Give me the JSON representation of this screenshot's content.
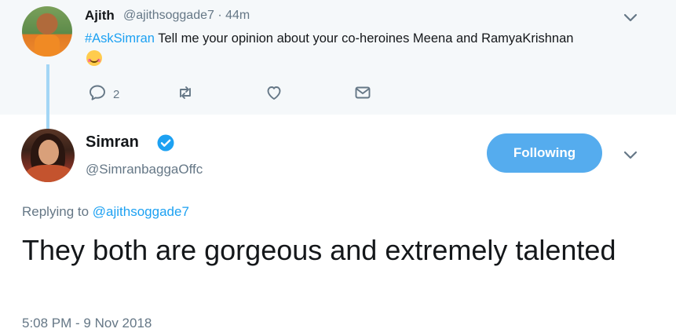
{
  "parent_tweet": {
    "name": "Ajith",
    "handle": "@ajithsoggade7",
    "separator": "·",
    "time": "44m",
    "hashtag": "#AskSimran",
    "text": " Tell me your opinion about your co-heroines Meena and RamyaKrishnan",
    "reply_count": "2"
  },
  "main_tweet": {
    "name": "Simran",
    "handle": "@SimranbaggaOffc",
    "follow_label": "Following",
    "replying_prefix": "Replying to ",
    "replying_to": "@ajithsoggade7",
    "text": "They both are gorgeous and extremely talented",
    "timestamp": "5:08 PM - 9 Nov 2018"
  },
  "icons": {
    "reply": "reply-icon",
    "retweet": "retweet-icon",
    "like": "heart-icon",
    "dm": "envelope-icon",
    "verified": "verified-badge-icon",
    "caret": "chevron-down-icon"
  },
  "colors": {
    "accent": "#1da1f2",
    "button": "#55acee",
    "muted": "#657786",
    "parent_bg": "#f5f8fa",
    "thread_line": "#a3d6f5"
  }
}
